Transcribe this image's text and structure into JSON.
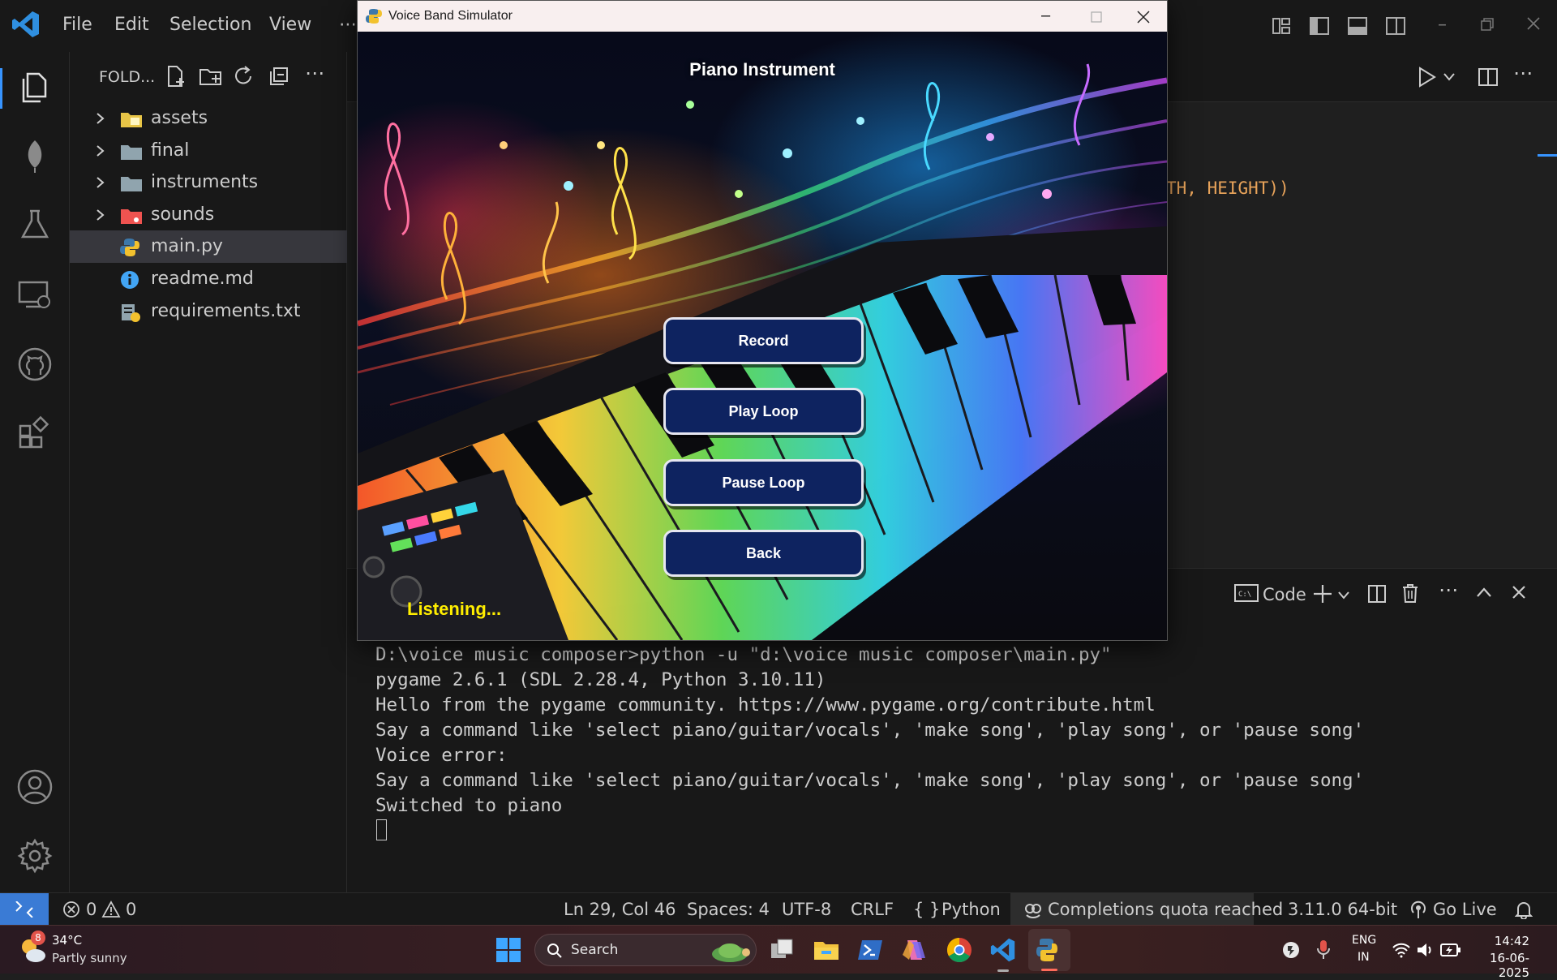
{
  "vscode": {
    "menu": [
      "File",
      "Edit",
      "Selection",
      "View",
      "⋯"
    ],
    "explorer_title": "FOLD...",
    "tree": [
      {
        "name": "assets",
        "type": "folder",
        "color": "#e8c547"
      },
      {
        "name": "final",
        "type": "folder",
        "color": "#90a4ae"
      },
      {
        "name": "instruments",
        "type": "folder",
        "color": "#90a4ae"
      },
      {
        "name": "sounds",
        "type": "folder",
        "color": "#ef5350"
      },
      {
        "name": "main.py",
        "type": "file",
        "selected": true
      },
      {
        "name": "readme.md",
        "type": "file"
      },
      {
        "name": "requirements.txt",
        "type": "file"
      }
    ],
    "code_fragment": "TH, HEIGHT))",
    "terminal": {
      "profile_label": "Code",
      "lines": [
        "D:\\voice music composer>python -u \"d:\\voice music composer\\main.py\"",
        "pygame 2.6.1 (SDL 2.28.4, Python 3.10.11)",
        "Hello from the pygame community. https://www.pygame.org/contribute.html",
        "Say a command like 'select piano/guitar/vocals', 'make song', 'play song', or 'pause song'",
        "Voice error:",
        "Say a command like 'select piano/guitar/vocals', 'make song', 'play song', or 'pause song'",
        "Switched to piano"
      ]
    },
    "status": {
      "errors": "0",
      "warnings": "0",
      "position": "Ln 29, Col 46",
      "spaces": "Spaces: 4",
      "encoding": "UTF-8",
      "eol": "CRLF",
      "language": "Python",
      "completions": "Completions quota reached",
      "interpreter": "3.11.0 64-bit",
      "golive": "Go Live"
    }
  },
  "pygame_window": {
    "title": "Voice Band Simulator",
    "heading": "Piano Instrument",
    "buttons": [
      "Record",
      "Play Loop",
      "Pause Loop",
      "Back"
    ],
    "status_text": "Listening...",
    "status_color": "#ffee00"
  },
  "taskbar": {
    "weather_temp": "34°C",
    "weather_desc": "Partly sunny",
    "weather_badge": "8",
    "search_placeholder": "Search",
    "lang_top": "ENG",
    "lang_bottom": "IN",
    "time": "14:42",
    "date": "16-06-2025"
  }
}
